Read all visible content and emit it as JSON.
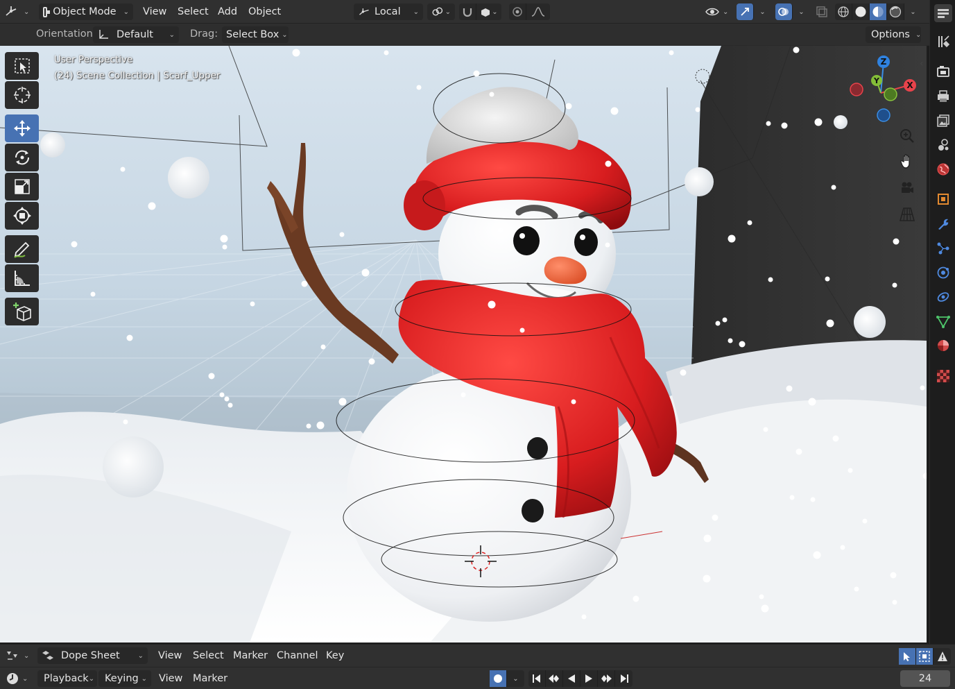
{
  "top_header": {
    "mode": "Object Mode",
    "menu": [
      "View",
      "Select",
      "Add",
      "Object"
    ],
    "transform_orientation": "Local",
    "options_label": "Options"
  },
  "tool_settings": {
    "orientation_label": "Orientation:",
    "orientation_value": "Default",
    "drag_label": "Drag:",
    "drag_value": "Select Box"
  },
  "viewport": {
    "view_name": "User Perspective",
    "collection_info": "(24) Scene Collection | Scarf_Upper",
    "gizmo_axes": [
      "Z",
      "Y",
      "X"
    ],
    "shading_mode_active": "solid",
    "active_tool": "move"
  },
  "tool_shelf": [
    "select-box",
    "cursor",
    "move",
    "rotate",
    "scale",
    "transform",
    "annotate",
    "measure",
    "add-cube"
  ],
  "properties_tabs": [
    "tool",
    "render",
    "output",
    "view-layer",
    "scene",
    "world",
    "object",
    "modifiers",
    "particles",
    "physics",
    "constraints",
    "data",
    "material",
    "texture"
  ],
  "dope_sheet": {
    "editor_type": "Dope Sheet",
    "menu": [
      "View",
      "Select",
      "Marker",
      "Channel",
      "Key"
    ]
  },
  "timeline": {
    "menu": [
      "Playback",
      "Keying",
      "View",
      "Marker"
    ],
    "current_frame": "24"
  },
  "colors": {
    "accent": "#4772b3",
    "header": "#303030",
    "scarf": "#c8161b"
  }
}
